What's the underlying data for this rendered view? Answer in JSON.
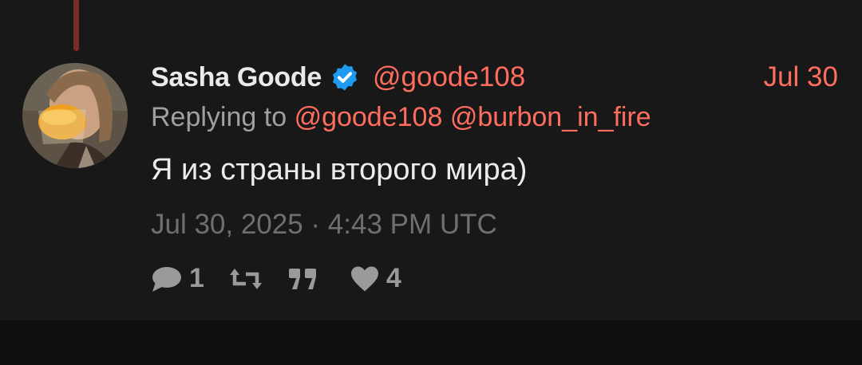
{
  "tweet": {
    "author_name": "Sasha Goode",
    "author_handle": "@goode108",
    "date_short": "Jul 30",
    "replying_prefix": "Replying to",
    "replying_to": [
      "@goode108",
      "@burbon_in_fire"
    ],
    "content": "Я из страны второго мира)",
    "timestamp": "Jul 30, 2025 · 4:43 PM UTC",
    "stats": {
      "replies": "1",
      "retweets": "",
      "quotes": "",
      "likes": "4"
    }
  },
  "colors": {
    "accent": "#ff6d5e",
    "background": "#181818",
    "thread_line": "#7a2b25",
    "verified": "#1d9bf0"
  },
  "icons": {
    "verified": "verified-badge-icon",
    "reply": "comment-icon",
    "retweet": "retweet-icon",
    "quote": "quote-icon",
    "like": "heart-icon"
  }
}
